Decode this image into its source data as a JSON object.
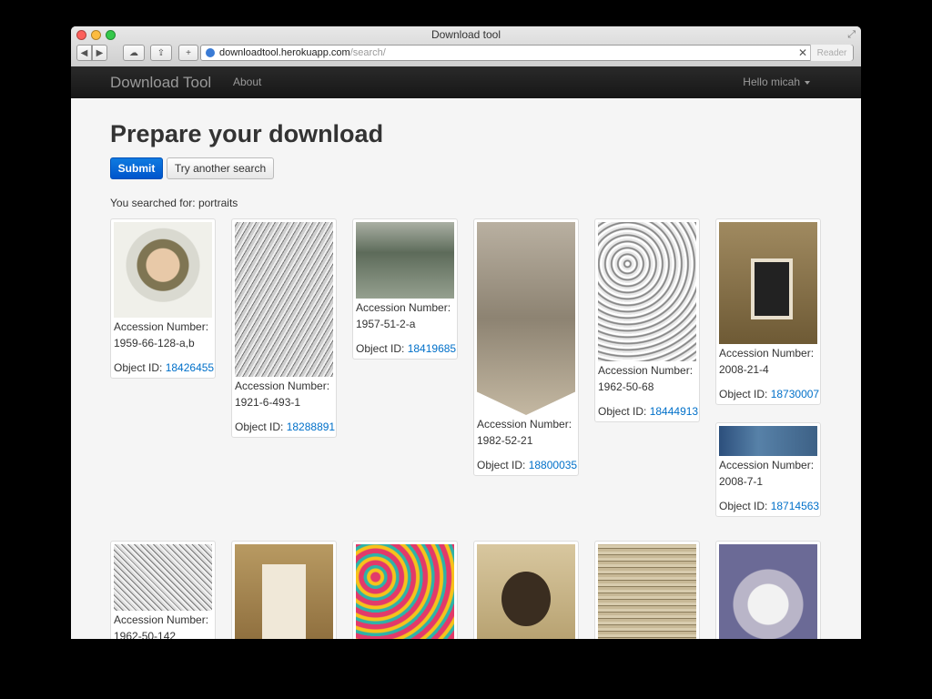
{
  "window": {
    "title": "Download tool"
  },
  "toolbar": {
    "back_icon": "back-arrow-icon",
    "forward_icon": "forward-arrow-icon",
    "cloud_icon": "icloud-tabs-icon",
    "share_icon": "share-icon",
    "add_icon": "plus-icon",
    "url_host": "downloadtool.herokuapp.com",
    "url_path": "/search/",
    "clear_glyph": "✕",
    "reader_label": "Reader"
  },
  "navbar": {
    "brand": "Download Tool",
    "about": "About",
    "user": "Hello micah"
  },
  "page": {
    "title": "Prepare your download",
    "submit": "Submit",
    "try_another": "Try another search",
    "searched_for": "You searched for: portraits"
  },
  "labels": {
    "accession": "Accession Number:",
    "object_id": "Object ID:"
  },
  "results": [
    {
      "accession": "1959-66-128-a,b",
      "object_id": "18426455",
      "thumb": "brooch"
    },
    {
      "accession": "1921-6-493-1",
      "object_id": "18288891",
      "thumb": "engraving"
    },
    {
      "accession": "1957-51-2-a",
      "object_id": "18419685",
      "thumb": "currency"
    },
    {
      "accession": "1982-52-21",
      "object_id": "18800035",
      "thumb": "ribbon"
    },
    {
      "accession": "1962-50-68",
      "object_id": "18444913",
      "thumb": "lace"
    },
    {
      "accession": "2008-21-4",
      "object_id": "18730007",
      "thumb": "framed-portrait"
    },
    {
      "accession": "2008-7-1",
      "object_id": "18714563",
      "thumb": "sign"
    },
    {
      "accession": "1962-50-142",
      "object_id": "",
      "thumb": "lace"
    },
    {
      "accession": "",
      "object_id": "",
      "thumb": "framed-victorie"
    },
    {
      "accession": "",
      "object_id": "",
      "thumb": "floral-print"
    },
    {
      "accession": "",
      "object_id": "",
      "thumb": "cleveland-banner"
    },
    {
      "accession": "",
      "object_id": "",
      "thumb": "sampler"
    },
    {
      "accession": "",
      "object_id": "",
      "thumb": "wreath-portrait"
    }
  ]
}
